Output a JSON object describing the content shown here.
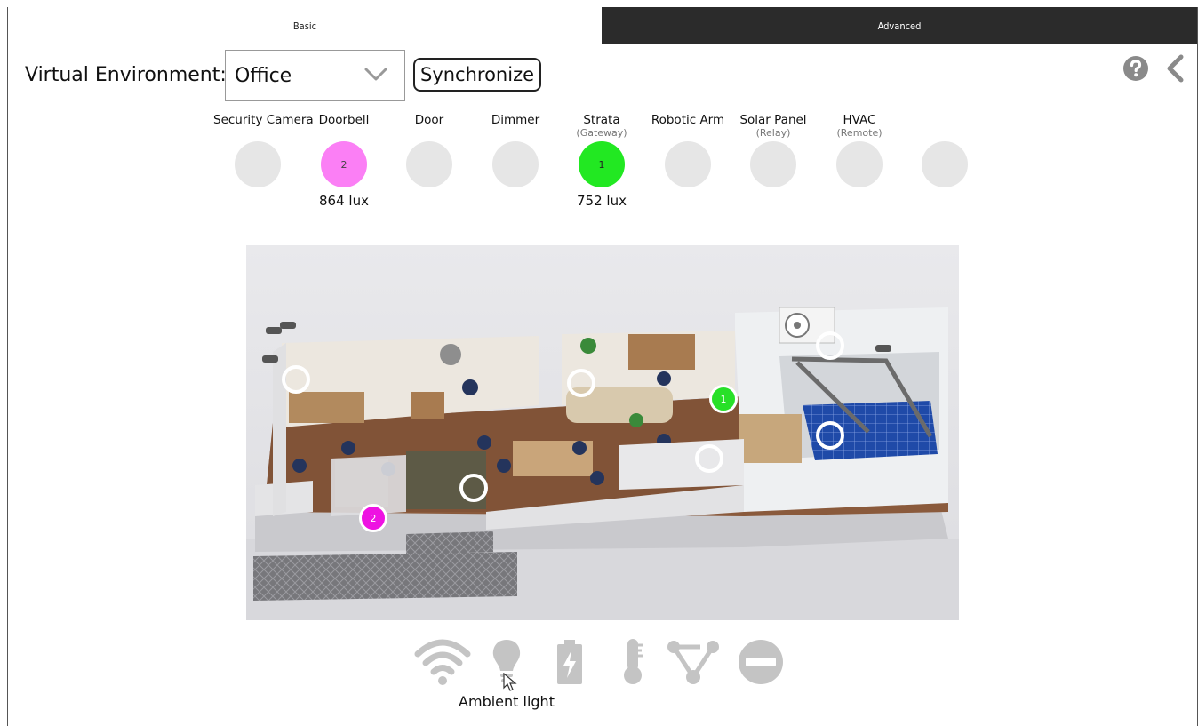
{
  "tabs": {
    "basic": "Basic",
    "advanced": "Advanced"
  },
  "env": {
    "label": "Virtual Environment:",
    "selected": "Office",
    "sync_label": "Synchronize"
  },
  "devices": [
    {
      "name": "Security Camera",
      "sub": "",
      "badge": "",
      "reading": ""
    },
    {
      "name": "Doorbell",
      "sub": "",
      "badge": "2",
      "reading": "864 lux"
    },
    {
      "name": "Door",
      "sub": "",
      "badge": "",
      "reading": ""
    },
    {
      "name": "Dimmer",
      "sub": "",
      "badge": "",
      "reading": ""
    },
    {
      "name": "Strata",
      "sub": "(Gateway)",
      "badge": "1",
      "reading": "752 lux"
    },
    {
      "name": "Robotic Arm",
      "sub": "",
      "badge": "",
      "reading": ""
    },
    {
      "name": "Solar Panel",
      "sub": "(Relay)",
      "badge": "",
      "reading": ""
    },
    {
      "name": "HVAC",
      "sub": "(Remote)",
      "badge": "",
      "reading": ""
    },
    {
      "name": "",
      "sub": "",
      "badge": "",
      "reading": ""
    }
  ],
  "scene": {
    "markers": [
      "",
      "",
      "",
      "1",
      "",
      "",
      "",
      "2"
    ]
  },
  "toolbar": {
    "icons": [
      "wifi-icon",
      "lightbulb-icon",
      "battery-icon",
      "thermometer-icon",
      "network-icon",
      "disable-icon"
    ],
    "caption": "Ambient light"
  },
  "colors": {
    "doorbell": "#fb7ff5",
    "strata": "#22e822",
    "marker_magenta": "#ee12e2",
    "marker_green": "#28e028",
    "icon_gray": "#c4c4c4",
    "tab_dark": "#2b2b2b"
  }
}
